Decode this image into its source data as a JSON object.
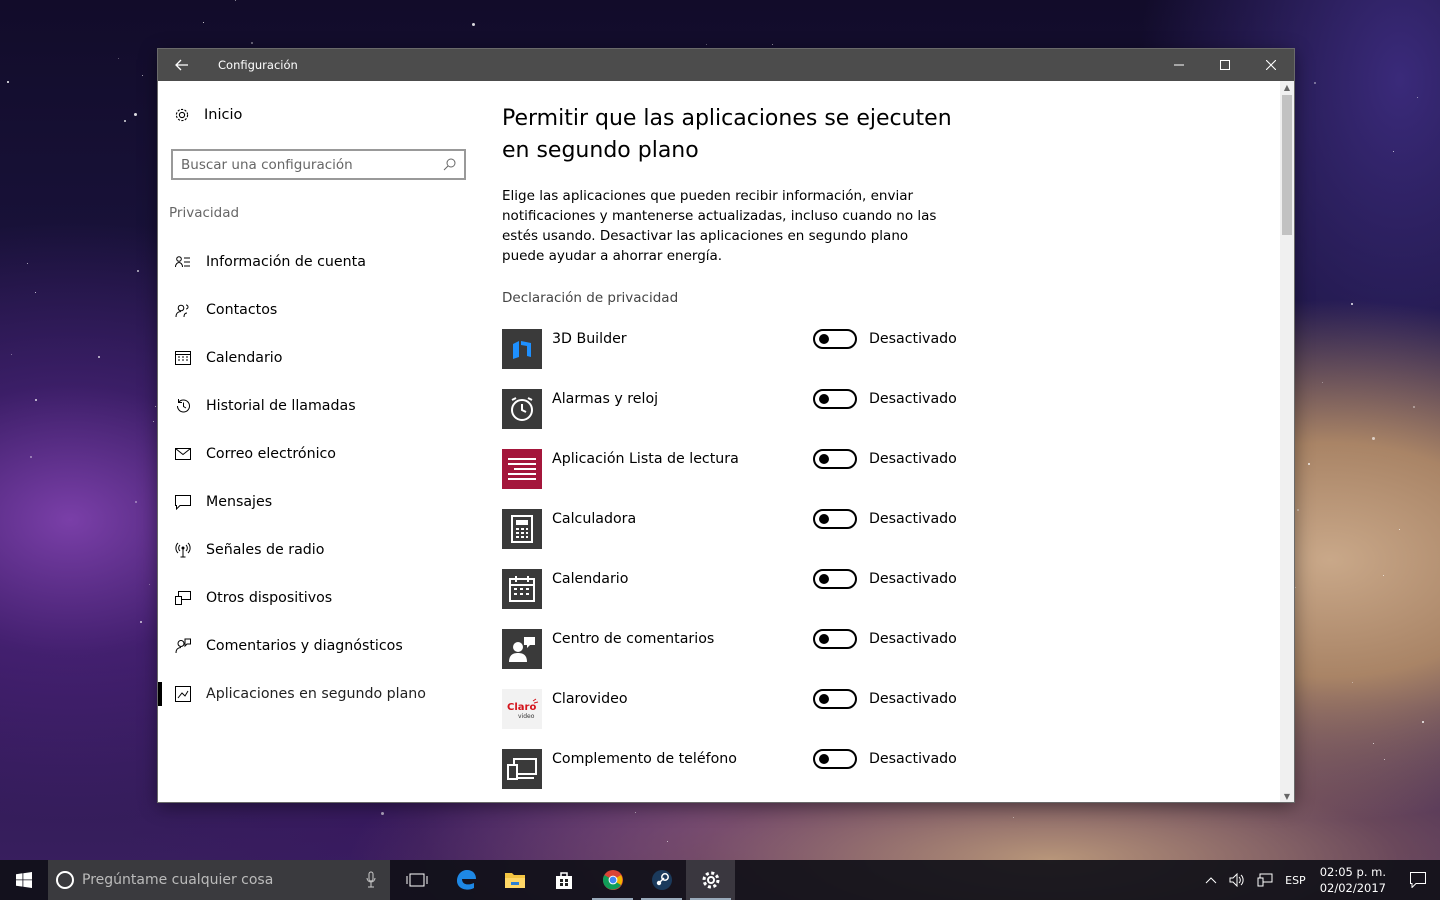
{
  "window": {
    "title": "Configuración",
    "back_icon": "arrow-left-icon",
    "controls": [
      "minimize-icon",
      "maximize-icon",
      "close-icon"
    ]
  },
  "sidebar": {
    "home_label": "Inicio",
    "search_placeholder": "Buscar una configuración",
    "section_label": "Privacidad",
    "items": [
      {
        "label": "Información de cuenta",
        "icon": "account-info-icon"
      },
      {
        "label": "Contactos",
        "icon": "contacts-icon"
      },
      {
        "label": "Calendario",
        "icon": "calendar-icon"
      },
      {
        "label": "Historial de llamadas",
        "icon": "history-icon"
      },
      {
        "label": "Correo electrónico",
        "icon": "mail-icon"
      },
      {
        "label": "Mensajes",
        "icon": "message-icon"
      },
      {
        "label": "Señales de radio",
        "icon": "radio-icon"
      },
      {
        "label": "Otros dispositivos",
        "icon": "devices-icon"
      },
      {
        "label": "Comentarios y diagnósticos",
        "icon": "feedback-icon"
      },
      {
        "label": "Aplicaciones en segundo plano",
        "icon": "background-apps-icon",
        "active": true
      }
    ]
  },
  "main": {
    "title": "Permitir que las aplicaciones se ejecuten en segundo plano",
    "description": "Elige las aplicaciones que pueden recibir información, enviar notificaciones y mantenerse actualizadas, incluso cuando no las estés usando. Desactivar las aplicaciones en segundo plano puede ayudar a ahorrar energía.",
    "privacy_link": "Declaración de privacidad",
    "apps": [
      {
        "name": "3D Builder",
        "state": "Desactivado",
        "on": false,
        "color": "#3a3a3a"
      },
      {
        "name": "Alarmas y reloj",
        "state": "Desactivado",
        "on": false,
        "color": "#3a3a3a"
      },
      {
        "name": "Aplicación Lista de lectura",
        "state": "Desactivado",
        "on": false,
        "color": "#a4163b"
      },
      {
        "name": "Calculadora",
        "state": "Desactivado",
        "on": false,
        "color": "#3a3a3a"
      },
      {
        "name": "Calendario",
        "state": "Desactivado",
        "on": false,
        "color": "#3a3a3a"
      },
      {
        "name": "Centro de comentarios",
        "state": "Desactivado",
        "on": false,
        "color": "#3a3a3a"
      },
      {
        "name": "Clarovideo",
        "state": "Desactivado",
        "on": false,
        "color": "#f2f2f2"
      },
      {
        "name": "Complemento de teléfono",
        "state": "Desactivado",
        "on": false,
        "color": "#3a3a3a"
      }
    ]
  },
  "taskbar": {
    "search_placeholder": "Pregúntame cualquier cosa",
    "apps": [
      "task-view-icon",
      "edge-icon",
      "file-explorer-icon",
      "store-icon",
      "chrome-icon",
      "steam-icon",
      "settings-icon"
    ],
    "language": "ESP",
    "time": "02:05 p. m.",
    "date": "02/02/2017"
  }
}
